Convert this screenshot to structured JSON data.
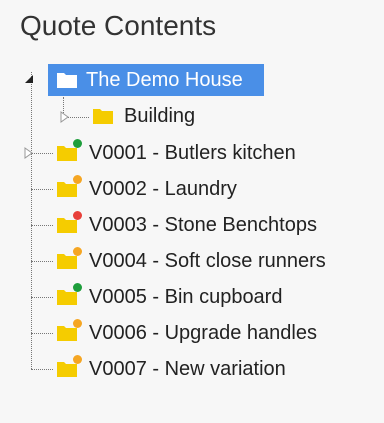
{
  "panel": {
    "title": "Quote Contents"
  },
  "colors": {
    "selected_bg": "#4a8fe7",
    "folder": "#f5cc00",
    "status_green": "#1e9e3c",
    "status_orange": "#f5a623",
    "status_red": "#e8403a"
  },
  "tree": {
    "root": {
      "label": "The Demo House",
      "icon": "folder-open-icon",
      "expanded": true,
      "selected": true
    },
    "building": {
      "label": "Building",
      "icon": "folder-icon",
      "expanded": false
    },
    "variations": [
      {
        "label": "V0001 - Butlers kitchen",
        "status": "green",
        "expandable": true
      },
      {
        "label": "V0002 - Laundry",
        "status": "orange",
        "expandable": false
      },
      {
        "label": "V0003 - Stone Benchtops",
        "status": "red",
        "expandable": false
      },
      {
        "label": "V0004 - Soft close runners",
        "status": "orange",
        "expandable": false
      },
      {
        "label": "V0005 - Bin cupboard",
        "status": "green",
        "expandable": false
      },
      {
        "label": "V0006 - Upgrade handles",
        "status": "orange",
        "expandable": false
      },
      {
        "label": "V0007 - New variation",
        "status": "orange",
        "expandable": false
      }
    ]
  }
}
